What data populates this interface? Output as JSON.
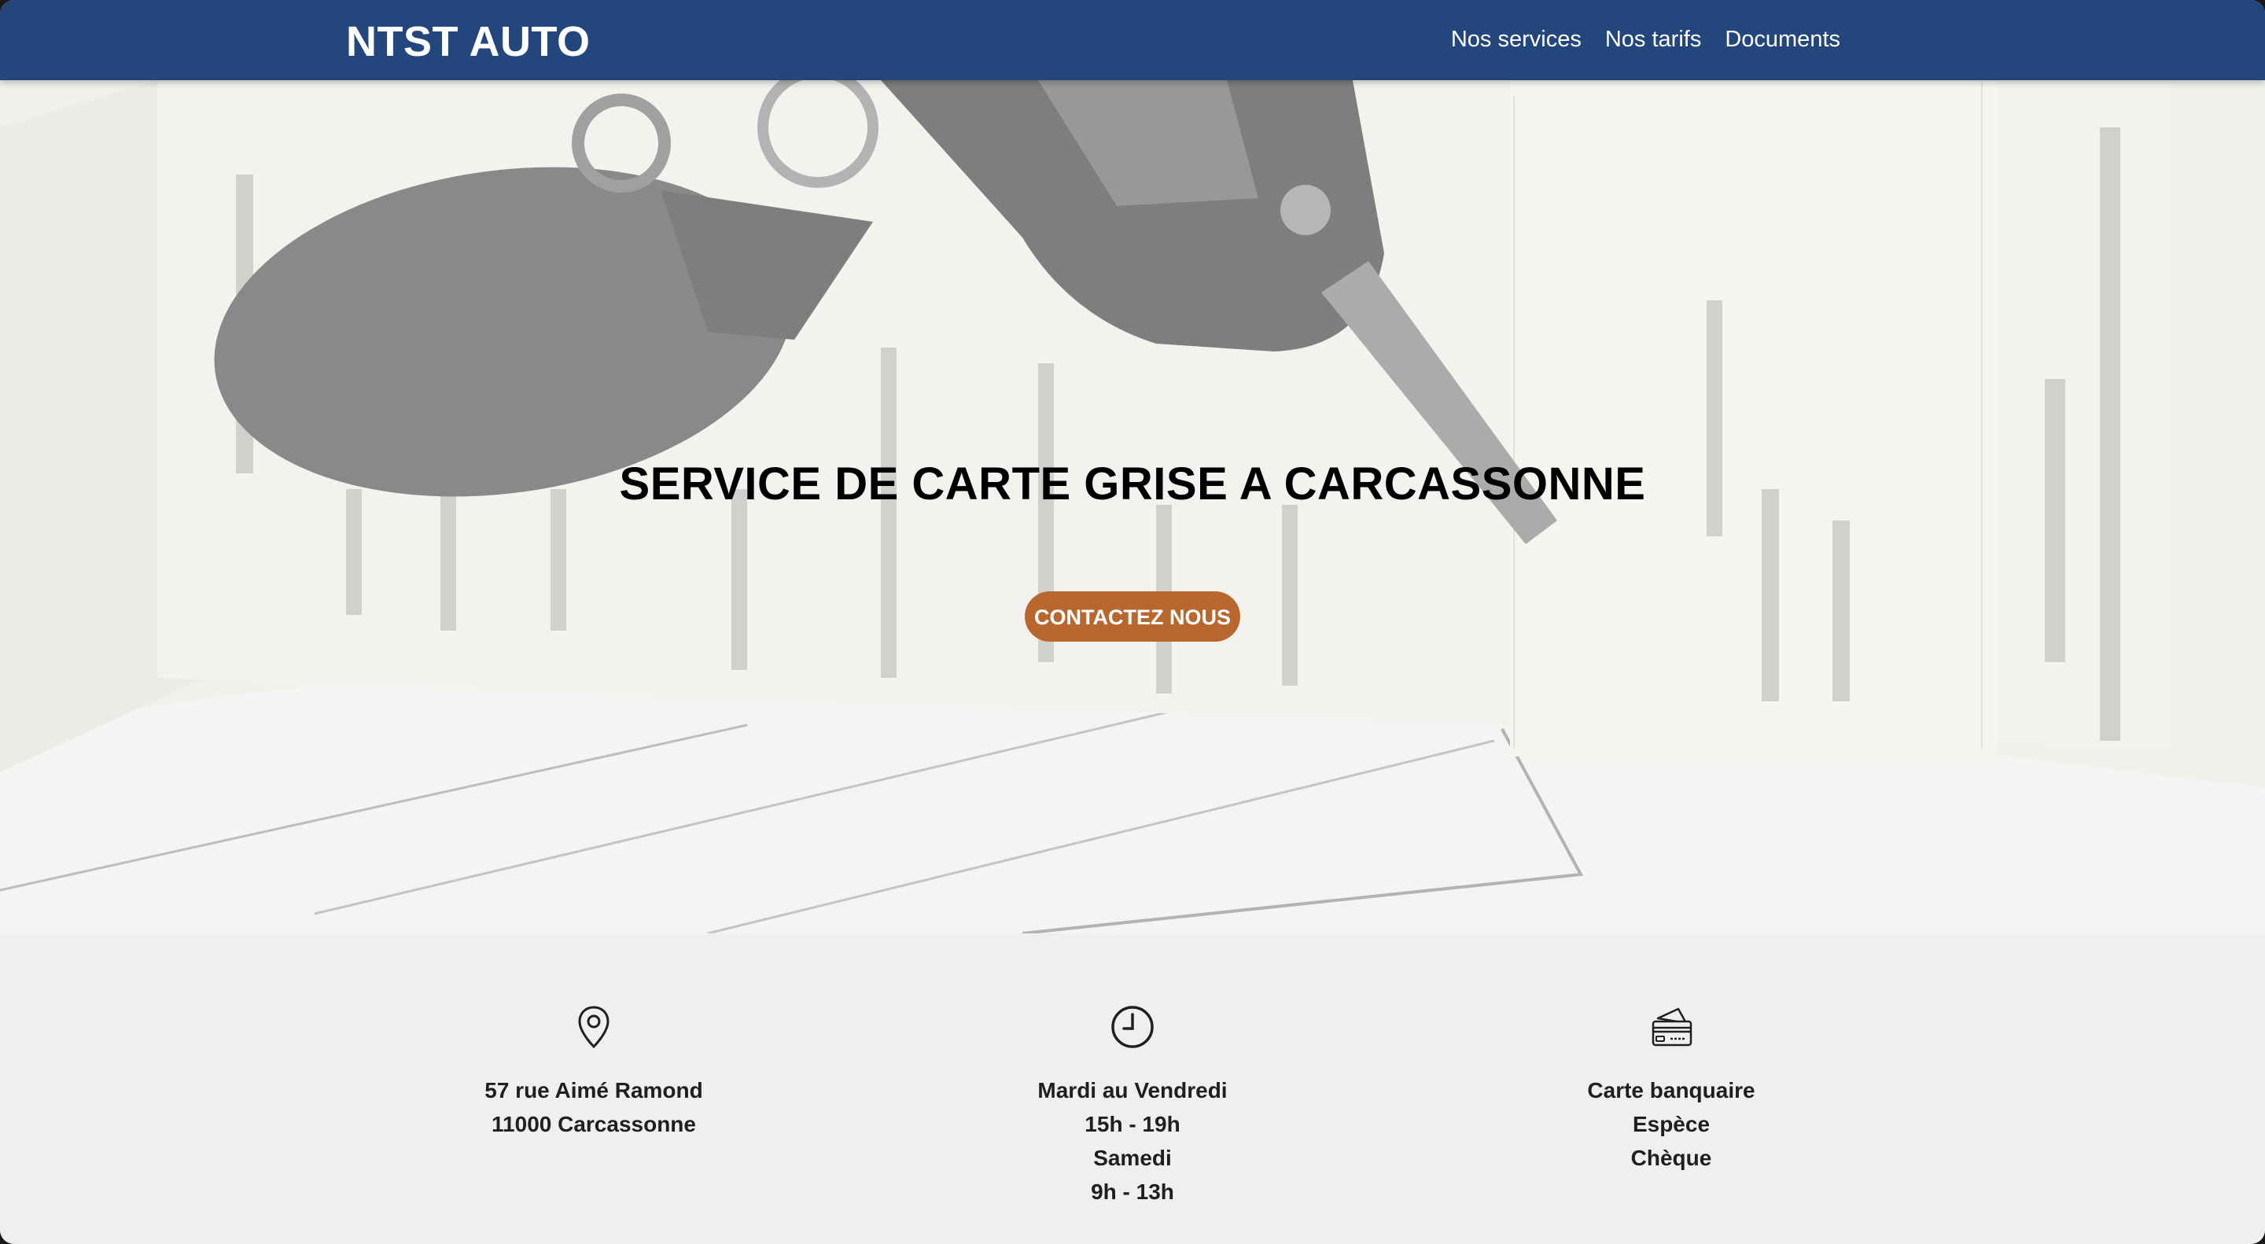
{
  "header": {
    "brand": "NTST AUTO",
    "nav": [
      "Nos services",
      "Nos tarifs",
      "Documents"
    ]
  },
  "hero": {
    "title": "SERVICE DE CARTE GRISE A CARCASSONNE",
    "cta_label": "CONTACTEZ NOUS",
    "background_image": "vehicle registration certificate with car key"
  },
  "info": {
    "address": {
      "icon": "map-pin-icon",
      "lines": [
        "57 rue Aimé Ramond",
        "11000 Carcassonne"
      ]
    },
    "hours": {
      "icon": "clock-icon",
      "lines": [
        "Mardi au Vendredi",
        "15h - 19h",
        "Samedi",
        "9h - 13h"
      ]
    },
    "payment": {
      "icon": "credit-card-icon",
      "lines": [
        "Carte banquaire",
        "Espèce",
        "Chèque"
      ]
    }
  },
  "colors": {
    "navbar": "#23477c",
    "cta": "#b8682f",
    "section_bg": "#efeef0"
  }
}
